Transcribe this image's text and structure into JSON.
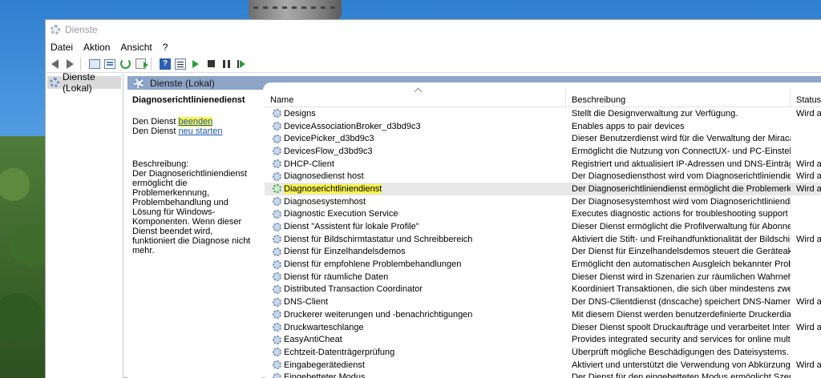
{
  "window": {
    "title": "Dienste"
  },
  "menu": [
    "Datei",
    "Aktion",
    "Ansicht",
    "?"
  ],
  "tree": {
    "root": "Dienste (Lokal)"
  },
  "panel_header": "Dienste (Lokal)",
  "extended": {
    "service_title": "Diagnoserichtlinienedienst",
    "stop_prefix": "Den Dienst ",
    "stop_link": "beenden",
    "restart_prefix": "Den Dienst ",
    "restart_link": "neu starten",
    "description_label": "Beschreibung:",
    "description": "Der Diagnoserichtliniendienst ermöglicht die Problemerkennung, Problembehandlung und Lösung für Windows-Komponenten. Wenn dieser Dienst beendet wird, funktioniert die Diagnose nicht mehr."
  },
  "columns": {
    "name": "Name",
    "description": "Beschreibung",
    "status": "Status"
  },
  "rows": [
    {
      "name": "Designs",
      "description": "Stellt die Designverwaltung zur Verfügung.",
      "status": "Wird au"
    },
    {
      "name": "DeviceAssociationBroker_d3bd9c3",
      "description": "Enables apps to pair devices",
      "status": ""
    },
    {
      "name": "DevicePicker_d3bd9c3",
      "description": "Dieser Benutzerdienst wird für die Verwaltung der Miracast-,...",
      "status": ""
    },
    {
      "name": "DevicesFlow_d3bd9c3",
      "description": "Ermöglicht die Nutzung von ConnectUX- und PC-Einstellun...",
      "status": ""
    },
    {
      "name": "DHCP-Client",
      "description": "Registriert und aktualisiert IP-Adressen und DNS-Einträge fü...",
      "status": "Wird au"
    },
    {
      "name": "Diagnosedienst host",
      "description": "Der Diagnosediensthost wird vom Diagnoserichtliniendienst...",
      "status": "Wird au"
    },
    {
      "name": "Diagnoserichtliniendienst",
      "description": "Der Diagnoserichtliniendienst ermöglicht die Problemerken...",
      "status": "Wird au",
      "selected": true
    },
    {
      "name": "Diagnosesystemhost",
      "description": "Der Diagnosesystemhost wird vom Diagnoserichtliniendien...",
      "status": ""
    },
    {
      "name": "Diagnostic Execution Service",
      "description": "Executes diagnostic actions for troubleshooting support",
      "status": ""
    },
    {
      "name": "Dienst \"Assistent für lokale Profile\"",
      "description": "Dieser Dienst ermöglicht die Profilverwaltung für Abonnent...",
      "status": ""
    },
    {
      "name": "Dienst für Bildschirmtastatur und Schreibbereich",
      "description": "Aktiviert die Stift- und Freihandfunktionalität der Bildschirm...",
      "status": "Wird au"
    },
    {
      "name": "Dienst für Einzelhandelsdemos",
      "description": "Der Dienst für Einzelhandelsdemos steuert die Geräteaktivitä...",
      "status": ""
    },
    {
      "name": "Dienst für empfohlene Problembehandlungen",
      "description": "Ermöglicht den automatischen Ausgleich bekannter Proble...",
      "status": ""
    },
    {
      "name": "Dienst für räumliche Daten",
      "description": "Dieser Dienst wird in Szenarien zur räumlichen Wahrnehmu...",
      "status": ""
    },
    {
      "name": "Distributed Transaction Coordinator",
      "description": "Koordiniert Transaktionen, die sich über mindestens zwei Re...",
      "status": ""
    },
    {
      "name": "DNS-Client",
      "description": "Der DNS-Clientdienst (dnscache) speichert DNS-Namen (D...",
      "status": "Wird au"
    },
    {
      "name": "Druckerer weiterungen und -benachrichtigungen",
      "description": "Mit diesem Dienst werden benutzerdefinierte Druckerdialog...",
      "status": ""
    },
    {
      "name": "Druckwarteschlange",
      "description": "Dieser Dienst spoolt Druckaufträge und verarbeitet Interakti...",
      "status": "Wird au"
    },
    {
      "name": "EasyAntiCheat",
      "description": "Provides integrated security and services for online multipla...",
      "status": ""
    },
    {
      "name": "Echtzeit-Datenträgerprüfung",
      "description": "Überprüft mögliche Beschädigungen des Dateisystems.",
      "status": ""
    },
    {
      "name": "Eingabegerätedienst",
      "description": "Aktiviert und unterstützt die Verwendung von Abkürzungstast...",
      "status": "Wird au"
    },
    {
      "name": "Eingebetteter Modus",
      "description": "Der Dienst für den eingebetteten Modus ermöglicht Szenari...",
      "status": ""
    }
  ]
}
